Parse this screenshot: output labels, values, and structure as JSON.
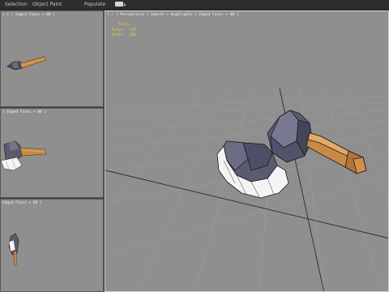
{
  "toolbar": {
    "tabs": [
      {
        "label": "Selection"
      },
      {
        "label": "Object Paint"
      },
      {
        "label": "Populate"
      }
    ],
    "camera_icon": "camera-icon"
  },
  "viewports": {
    "top": {
      "label": "+ ] ] Edged Faces + 00 ]"
    },
    "front": {
      "label": "] Edged Faces + 00 ]"
    },
    "left": {
      "label": "Edged Faces + 00 ]"
    },
    "perspective": {
      "label": "[ + ] Perspective ] Smooth + Highlights + Edged Faces + 00 ]"
    }
  },
  "stats": {
    "title": "Total",
    "rows": [
      {
        "key": "Polys:",
        "value": "135"
      },
      {
        "key": "Verts:",
        "value": "182"
      }
    ]
  },
  "colors": {
    "viewport_bg": "#8f8f8f",
    "axe_head": "#5a5a6e",
    "axe_blade": "#f2f2f2",
    "axe_handle": "#c98a46",
    "stats_text": "#e8d24a"
  }
}
